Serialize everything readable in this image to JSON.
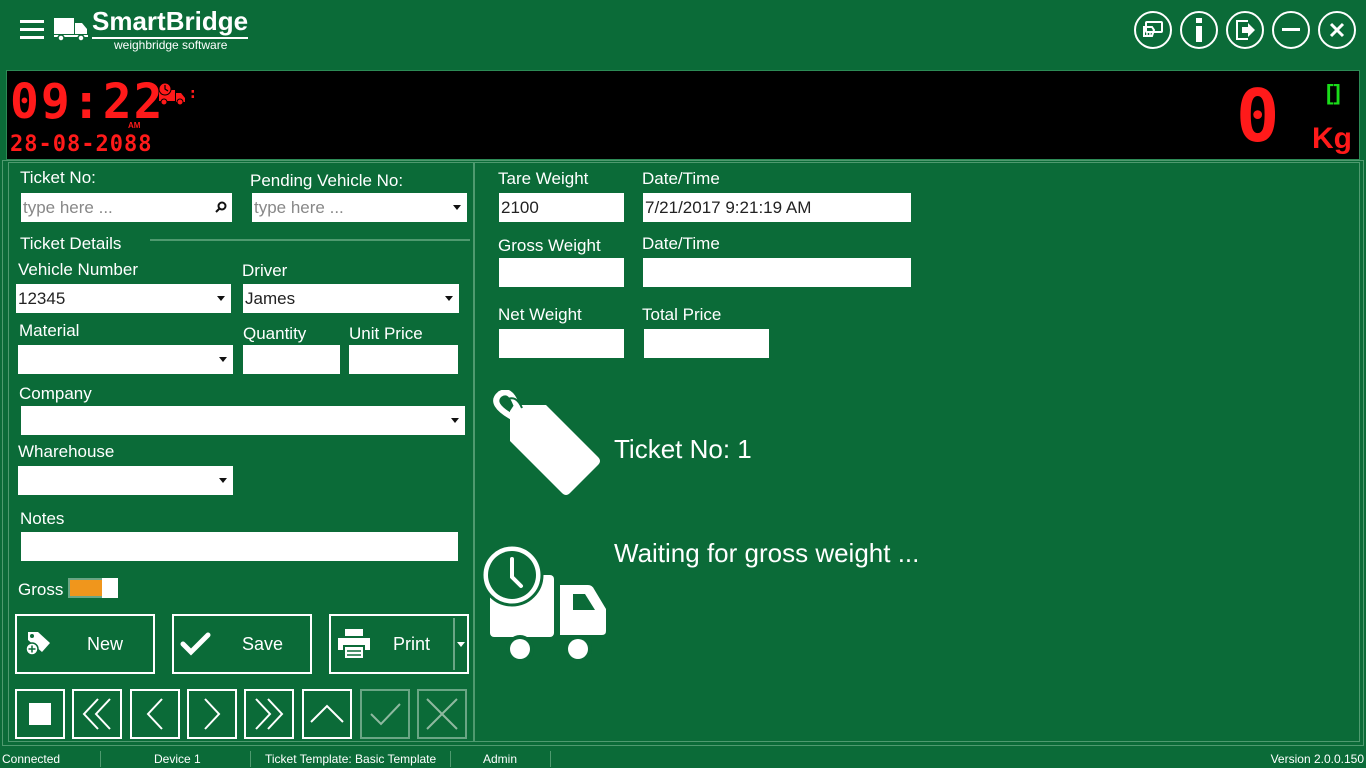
{
  "app": {
    "brand": "SmartBridge",
    "tagline": "weighbridge software"
  },
  "window_buttons": [
    {
      "name": "card-payment-icon"
    },
    {
      "name": "info-icon"
    },
    {
      "name": "logout-icon"
    },
    {
      "name": "minimize-icon"
    },
    {
      "name": "close-icon"
    }
  ],
  "display": {
    "time": "09:22",
    "ampm": "AM",
    "date": "28-08-2088",
    "weight": "0",
    "unit": "Kg",
    "stable_indicator": "[]",
    "led_color": "#ff1a1a",
    "stable_color": "#1adc1a"
  },
  "ticket_search": {
    "label": "Ticket No:",
    "placeholder": "type here ..."
  },
  "pending_vehicle": {
    "label": "Pending Vehicle No:",
    "placeholder": "type here ..."
  },
  "ticket_details": {
    "section_label": "Ticket Details",
    "vehicle_number": {
      "label": "Vehicle Number",
      "value": "12345"
    },
    "driver": {
      "label": "Driver",
      "value": "James"
    },
    "material": {
      "label": "Material",
      "value": ""
    },
    "quantity": {
      "label": "Quantity",
      "value": ""
    },
    "unit_price": {
      "label": "Unit Price",
      "value": ""
    },
    "company": {
      "label": "Company",
      "value": ""
    },
    "warehouse": {
      "label": "Wharehouse",
      "value": ""
    },
    "notes": {
      "label": "Notes",
      "value": ""
    },
    "gross_toggle": {
      "label": "Gross",
      "on": true,
      "color": "#f0961c"
    }
  },
  "actions": {
    "new_label": "New",
    "save_label": "Save",
    "print_label": "Print"
  },
  "navigation": [
    {
      "name": "stop-button",
      "icon": "square-icon",
      "enabled": true
    },
    {
      "name": "first-record-button",
      "icon": "double-chevron-left-icon",
      "enabled": true
    },
    {
      "name": "previous-record-button",
      "icon": "chevron-left-icon",
      "enabled": true
    },
    {
      "name": "next-record-button",
      "icon": "chevron-right-icon",
      "enabled": true
    },
    {
      "name": "last-record-button",
      "icon": "double-chevron-right-icon",
      "enabled": true
    },
    {
      "name": "up-button",
      "icon": "chevron-up-icon",
      "enabled": true
    },
    {
      "name": "confirm-button",
      "icon": "check-icon",
      "enabled": false
    },
    {
      "name": "cancel-button",
      "icon": "x-icon",
      "enabled": false
    }
  ],
  "weights": {
    "tare": {
      "label": "Tare Weight",
      "value": "2100"
    },
    "tare_datetime": {
      "label": "Date/Time",
      "value": "7/21/2017 9:21:19 AM"
    },
    "gross": {
      "label": "Gross Weight",
      "value": ""
    },
    "gross_datetime": {
      "label": "Date/Time",
      "value": ""
    },
    "net": {
      "label": "Net Weight",
      "value": ""
    },
    "total_price": {
      "label": "Total Price",
      "value": ""
    }
  },
  "info": {
    "ticket_text": "Ticket No: 1",
    "status_text": "Waiting for gross weight ..."
  },
  "statusbar": {
    "connection": "Connected",
    "device": "Device 1",
    "template": "Ticket Template: Basic Template",
    "user": "Admin",
    "version": "Version 2.0.0.150"
  }
}
